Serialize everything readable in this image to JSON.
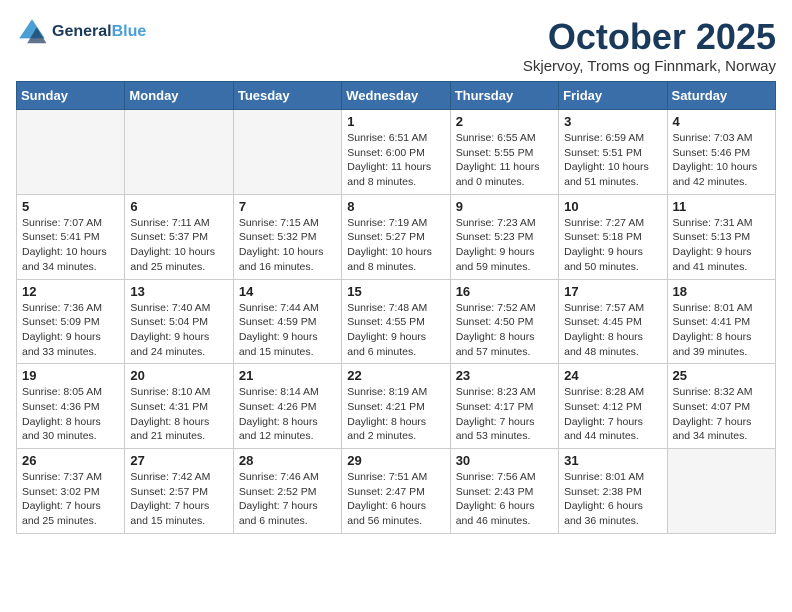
{
  "header": {
    "logo_line1": "General",
    "logo_line2": "Blue",
    "month": "October 2025",
    "location": "Skjervoy, Troms og Finnmark, Norway"
  },
  "weekdays": [
    "Sunday",
    "Monday",
    "Tuesday",
    "Wednesday",
    "Thursday",
    "Friday",
    "Saturday"
  ],
  "weeks": [
    [
      {
        "day": "",
        "sunrise": "",
        "sunset": "",
        "daylight": ""
      },
      {
        "day": "",
        "sunrise": "",
        "sunset": "",
        "daylight": ""
      },
      {
        "day": "",
        "sunrise": "",
        "sunset": "",
        "daylight": ""
      },
      {
        "day": "1",
        "sunrise": "Sunrise: 6:51 AM",
        "sunset": "Sunset: 6:00 PM",
        "daylight": "Daylight: 11 hours and 8 minutes."
      },
      {
        "day": "2",
        "sunrise": "Sunrise: 6:55 AM",
        "sunset": "Sunset: 5:55 PM",
        "daylight": "Daylight: 11 hours and 0 minutes."
      },
      {
        "day": "3",
        "sunrise": "Sunrise: 6:59 AM",
        "sunset": "Sunset: 5:51 PM",
        "daylight": "Daylight: 10 hours and 51 minutes."
      },
      {
        "day": "4",
        "sunrise": "Sunrise: 7:03 AM",
        "sunset": "Sunset: 5:46 PM",
        "daylight": "Daylight: 10 hours and 42 minutes."
      }
    ],
    [
      {
        "day": "5",
        "sunrise": "Sunrise: 7:07 AM",
        "sunset": "Sunset: 5:41 PM",
        "daylight": "Daylight: 10 hours and 34 minutes."
      },
      {
        "day": "6",
        "sunrise": "Sunrise: 7:11 AM",
        "sunset": "Sunset: 5:37 PM",
        "daylight": "Daylight: 10 hours and 25 minutes."
      },
      {
        "day": "7",
        "sunrise": "Sunrise: 7:15 AM",
        "sunset": "Sunset: 5:32 PM",
        "daylight": "Daylight: 10 hours and 16 minutes."
      },
      {
        "day": "8",
        "sunrise": "Sunrise: 7:19 AM",
        "sunset": "Sunset: 5:27 PM",
        "daylight": "Daylight: 10 hours and 8 minutes."
      },
      {
        "day": "9",
        "sunrise": "Sunrise: 7:23 AM",
        "sunset": "Sunset: 5:23 PM",
        "daylight": "Daylight: 9 hours and 59 minutes."
      },
      {
        "day": "10",
        "sunrise": "Sunrise: 7:27 AM",
        "sunset": "Sunset: 5:18 PM",
        "daylight": "Daylight: 9 hours and 50 minutes."
      },
      {
        "day": "11",
        "sunrise": "Sunrise: 7:31 AM",
        "sunset": "Sunset: 5:13 PM",
        "daylight": "Daylight: 9 hours and 41 minutes."
      }
    ],
    [
      {
        "day": "12",
        "sunrise": "Sunrise: 7:36 AM",
        "sunset": "Sunset: 5:09 PM",
        "daylight": "Daylight: 9 hours and 33 minutes."
      },
      {
        "day": "13",
        "sunrise": "Sunrise: 7:40 AM",
        "sunset": "Sunset: 5:04 PM",
        "daylight": "Daylight: 9 hours and 24 minutes."
      },
      {
        "day": "14",
        "sunrise": "Sunrise: 7:44 AM",
        "sunset": "Sunset: 4:59 PM",
        "daylight": "Daylight: 9 hours and 15 minutes."
      },
      {
        "day": "15",
        "sunrise": "Sunrise: 7:48 AM",
        "sunset": "Sunset: 4:55 PM",
        "daylight": "Daylight: 9 hours and 6 minutes."
      },
      {
        "day": "16",
        "sunrise": "Sunrise: 7:52 AM",
        "sunset": "Sunset: 4:50 PM",
        "daylight": "Daylight: 8 hours and 57 minutes."
      },
      {
        "day": "17",
        "sunrise": "Sunrise: 7:57 AM",
        "sunset": "Sunset: 4:45 PM",
        "daylight": "Daylight: 8 hours and 48 minutes."
      },
      {
        "day": "18",
        "sunrise": "Sunrise: 8:01 AM",
        "sunset": "Sunset: 4:41 PM",
        "daylight": "Daylight: 8 hours and 39 minutes."
      }
    ],
    [
      {
        "day": "19",
        "sunrise": "Sunrise: 8:05 AM",
        "sunset": "Sunset: 4:36 PM",
        "daylight": "Daylight: 8 hours and 30 minutes."
      },
      {
        "day": "20",
        "sunrise": "Sunrise: 8:10 AM",
        "sunset": "Sunset: 4:31 PM",
        "daylight": "Daylight: 8 hours and 21 minutes."
      },
      {
        "day": "21",
        "sunrise": "Sunrise: 8:14 AM",
        "sunset": "Sunset: 4:26 PM",
        "daylight": "Daylight: 8 hours and 12 minutes."
      },
      {
        "day": "22",
        "sunrise": "Sunrise: 8:19 AM",
        "sunset": "Sunset: 4:21 PM",
        "daylight": "Daylight: 8 hours and 2 minutes."
      },
      {
        "day": "23",
        "sunrise": "Sunrise: 8:23 AM",
        "sunset": "Sunset: 4:17 PM",
        "daylight": "Daylight: 7 hours and 53 minutes."
      },
      {
        "day": "24",
        "sunrise": "Sunrise: 8:28 AM",
        "sunset": "Sunset: 4:12 PM",
        "daylight": "Daylight: 7 hours and 44 minutes."
      },
      {
        "day": "25",
        "sunrise": "Sunrise: 8:32 AM",
        "sunset": "Sunset: 4:07 PM",
        "daylight": "Daylight: 7 hours and 34 minutes."
      }
    ],
    [
      {
        "day": "26",
        "sunrise": "Sunrise: 7:37 AM",
        "sunset": "Sunset: 3:02 PM",
        "daylight": "Daylight: 7 hours and 25 minutes."
      },
      {
        "day": "27",
        "sunrise": "Sunrise: 7:42 AM",
        "sunset": "Sunset: 2:57 PM",
        "daylight": "Daylight: 7 hours and 15 minutes."
      },
      {
        "day": "28",
        "sunrise": "Sunrise: 7:46 AM",
        "sunset": "Sunset: 2:52 PM",
        "daylight": "Daylight: 7 hours and 6 minutes."
      },
      {
        "day": "29",
        "sunrise": "Sunrise: 7:51 AM",
        "sunset": "Sunset: 2:47 PM",
        "daylight": "Daylight: 6 hours and 56 minutes."
      },
      {
        "day": "30",
        "sunrise": "Sunrise: 7:56 AM",
        "sunset": "Sunset: 2:43 PM",
        "daylight": "Daylight: 6 hours and 46 minutes."
      },
      {
        "day": "31",
        "sunrise": "Sunrise: 8:01 AM",
        "sunset": "Sunset: 2:38 PM",
        "daylight": "Daylight: 6 hours and 36 minutes."
      },
      {
        "day": "",
        "sunrise": "",
        "sunset": "",
        "daylight": ""
      }
    ]
  ]
}
